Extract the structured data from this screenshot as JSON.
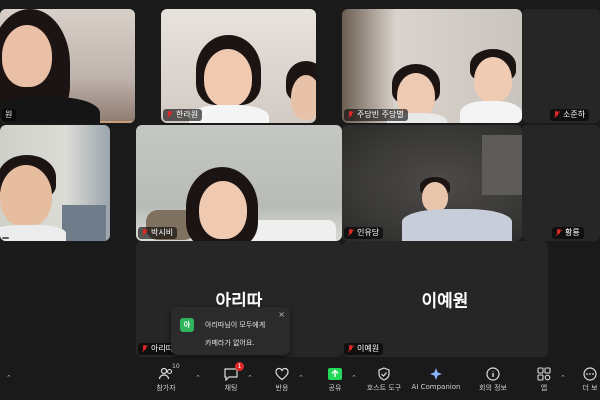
{
  "participants": [
    {
      "name": "원",
      "muted": false
    },
    {
      "name": "한라원",
      "muted": true
    },
    {
      "name": "주당빈 주당별",
      "muted": true
    },
    {
      "name": "소준하",
      "muted": true
    },
    {
      "name": "",
      "muted": false
    },
    {
      "name": "박시비",
      "muted": true
    },
    {
      "name": "인유당",
      "muted": true
    },
    {
      "name": "황룡",
      "muted": true
    },
    {
      "name": "아리따",
      "muted": true,
      "display_name": "아리따",
      "video_off": true
    },
    {
      "name": "이예원",
      "muted": true,
      "display_name": "이예원",
      "video_off": true
    }
  ],
  "toast": {
    "avatar": "아",
    "title": "아리따님이 모두에게",
    "message": "카메라가 없어요.",
    "close": "×"
  },
  "toolbar": {
    "participants": {
      "label": "참가자",
      "count": "10",
      "icon": "participants-icon"
    },
    "chat": {
      "label": "채팅",
      "badge": "1",
      "icon": "chat-icon"
    },
    "reactions": {
      "label": "반응",
      "icon": "heart-icon"
    },
    "share": {
      "label": "공유",
      "icon": "share-icon"
    },
    "host_tools": {
      "label": "호스트 도구",
      "icon": "shield-icon"
    },
    "ai_companion": {
      "label": "AI Companion",
      "icon": "sparkle-icon"
    },
    "meeting_info": {
      "label": "회의 정보",
      "icon": "info-icon"
    },
    "apps": {
      "label": "앱",
      "icon": "apps-icon"
    },
    "more": {
      "label": "더 보",
      "icon": "more-icon"
    }
  },
  "colors": {
    "active_speaker": "#23d959",
    "muted": "#e02828",
    "share_green": "#23d959",
    "badge": "#e02828"
  }
}
